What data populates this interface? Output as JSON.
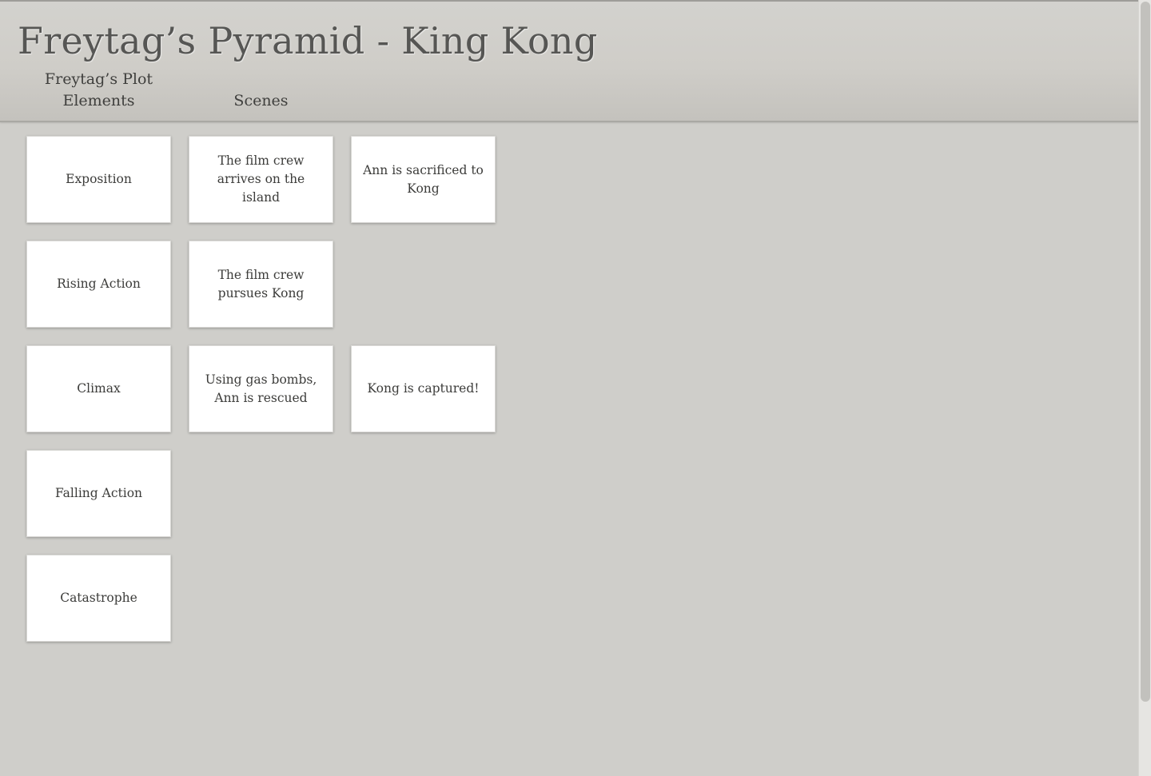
{
  "title": "Freytag’s Pyramid - King Kong",
  "columns": {
    "plot_elements": "Freytag’s Plot Elements",
    "scenes": "Scenes"
  },
  "rows": [
    {
      "element": "Exposition",
      "scenes": [
        "The film crew arrives on the island",
        "Ann is sacrificed to Kong"
      ]
    },
    {
      "element": "Rising Action",
      "scenes": [
        "The film crew pursues Kong"
      ]
    },
    {
      "element": "Climax",
      "scenes": [
        "Using gas bombs, Ann is rescued",
        "Kong is captured!"
      ]
    },
    {
      "element": "Falling Action",
      "scenes": []
    },
    {
      "element": "Catastrophe",
      "scenes": []
    }
  ]
}
